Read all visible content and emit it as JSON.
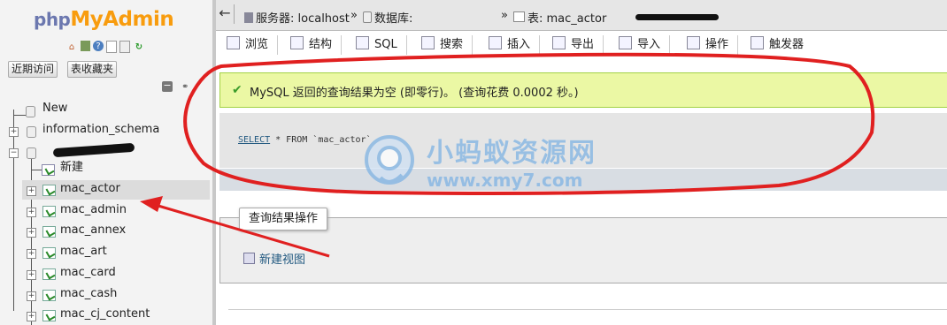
{
  "logo": {
    "php": "php",
    "myadmin": "MyAdmin"
  },
  "nav": {
    "recent_label": "近期访问",
    "favorites_label": "表收藏夹",
    "tree": [
      {
        "label": "New"
      },
      {
        "label": "information_schema"
      },
      {
        "label": "新建"
      },
      {
        "label": "mac_actor"
      },
      {
        "label": "mac_admin"
      },
      {
        "label": "mac_annex"
      },
      {
        "label": "mac_art"
      },
      {
        "label": "mac_card"
      },
      {
        "label": "mac_cash"
      },
      {
        "label": "mac_cj_content"
      }
    ]
  },
  "breadcrumb": {
    "server": "服务器: localhost",
    "sep1": "»",
    "database": "数据库:",
    "sep2": "»",
    "table": "表: mac_actor"
  },
  "tabs": [
    "浏览",
    "结构",
    "SQL",
    "搜索",
    "插入",
    "导出",
    "导入",
    "操作",
    "触发器"
  ],
  "success": {
    "message": "MySQL 返回的查询结果为空 (即零行)。 (查询花费 0.0002 秒。)"
  },
  "sql": {
    "keyword1": "SELECT",
    "rest1": " * FROM ",
    "table": "`mac_actor`"
  },
  "ops": {
    "legend": "查询结果操作",
    "new_view": "新建视图"
  },
  "watermark": {
    "text": "小蚂蚁资源网",
    "url": "www.xmy7.com"
  },
  "colors": {
    "success_bg": "#ebf8a4",
    "annotation_red": "#e02020",
    "link": "#235a81"
  }
}
